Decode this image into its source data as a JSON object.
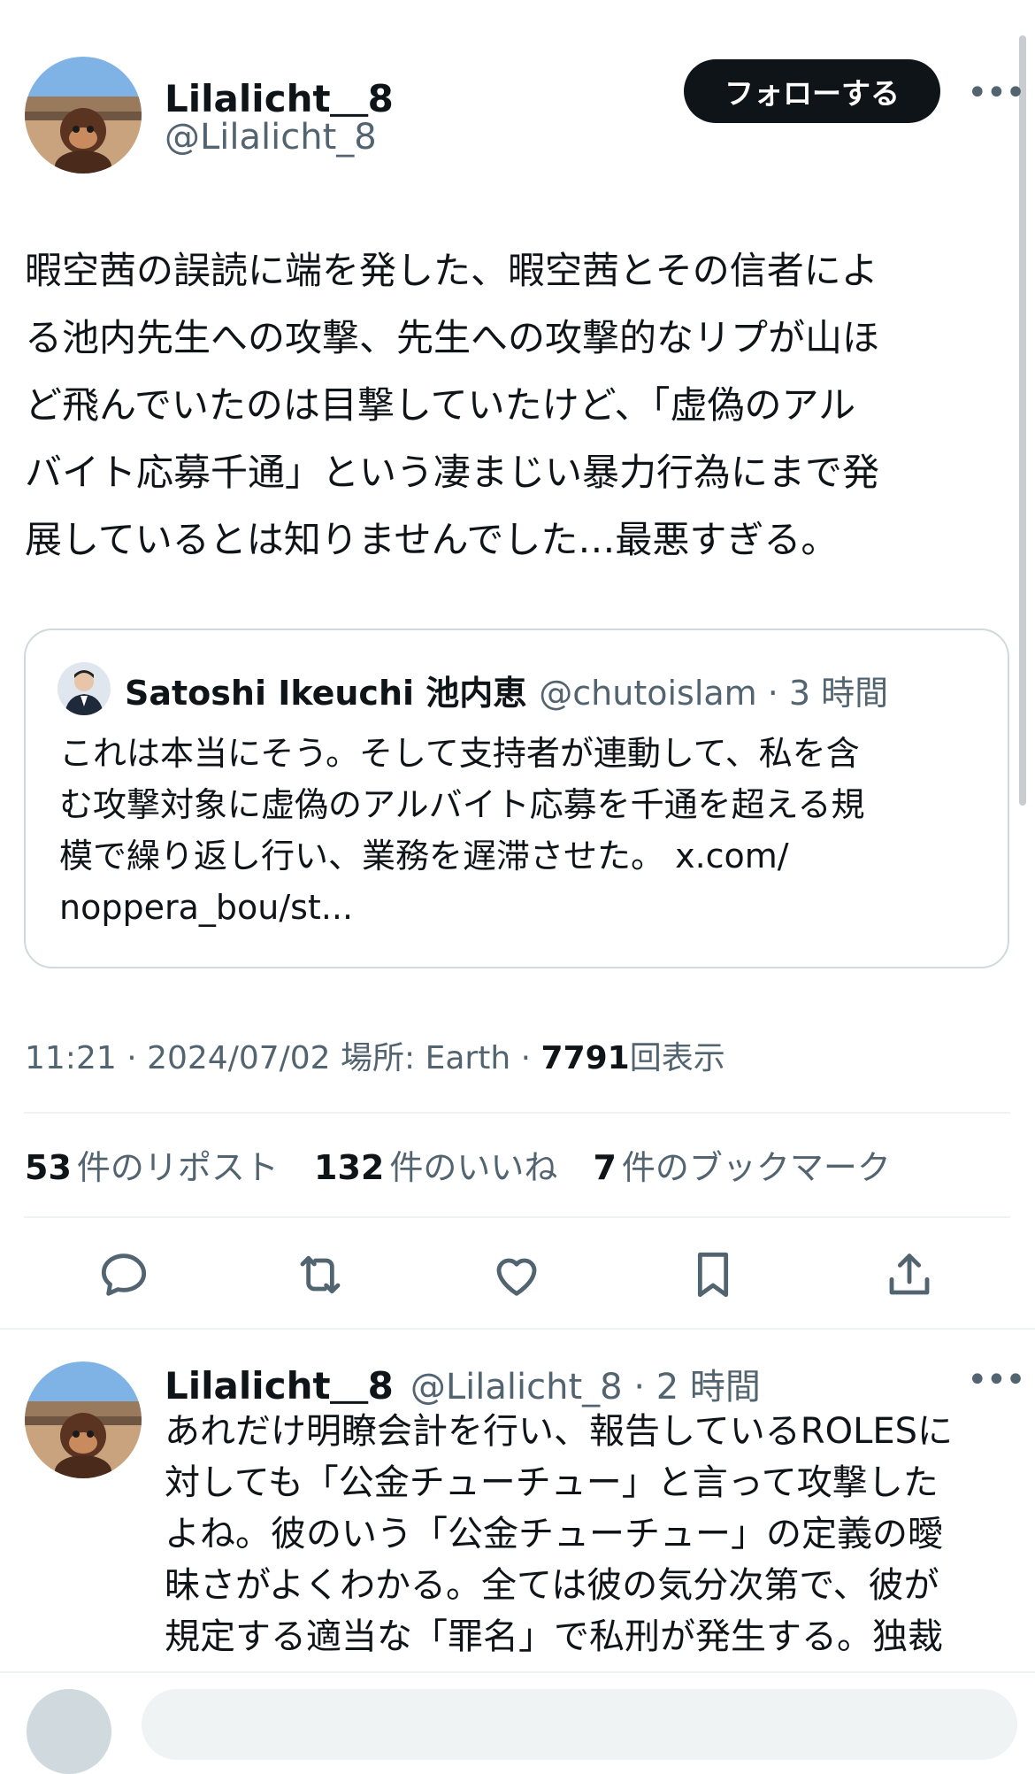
{
  "tweet": {
    "author_name": "Lilalicht＿8",
    "author_handle": "@Lilalicht_8",
    "follow_label": "フォローする",
    "more_label": "•••",
    "text_lines": [
      "暇空茜の誤読に端を発した、暇空茜とその信者によ",
      "る池内先生への攻撃、先生への攻撃的なリプが山ほ",
      "ど飛んでいたのは目撃していたけど、「虚偽のアル",
      "バイト応募千通」という凄まじい暴力行為にまで発",
      "展しているとは知りませんでした…最悪すぎる。"
    ],
    "quote": {
      "name": "Satoshi Ikeuchi 池内恵",
      "handle_time": "@chutoislam · 3 時間",
      "text_lines": [
        "これは本当にそう。そして支持者が連動して、私を含",
        "む攻撃対象に虚偽のアルバイト応募を千通を超える規",
        "模で繰り返し行い、業務を遅滞させた。 x.com/",
        "noppera_bou/st..."
      ]
    },
    "meta": {
      "time_date": "11:21 · 2024/07/02",
      "location": "場所: Earth",
      "separator": "·",
      "views_count": "7791",
      "views_label": "回表示"
    },
    "stats": [
      {
        "count": "53",
        "label": "件のリポスト"
      },
      {
        "count": "132",
        "label": "件のいいね"
      },
      {
        "count": "7",
        "label": "件のブックマーク"
      }
    ],
    "actions": [
      "reply-icon",
      "repost-icon",
      "like-icon",
      "bookmark-icon",
      "share-icon"
    ]
  },
  "reply": {
    "author_name": "Lilalicht＿8",
    "handle_time": "@Lilalicht_8 · 2 時間",
    "more_label": "•••",
    "text_lines": [
      "あれだけ明瞭会計を行い、報告しているROLESに",
      "対しても「公金チューチュー」と言って攻撃した",
      "よね。彼のいう「公金チューチュー」の定義の曖",
      "昧さがよくわかる。全ては彼の気分次第で、彼が",
      "規定する適当な「罪名」で私刑が発生する。独裁"
    ]
  },
  "colors": {
    "text": "#0f1419",
    "muted": "#536471",
    "border": "#cfd9de",
    "button_bg": "#0f1419"
  }
}
